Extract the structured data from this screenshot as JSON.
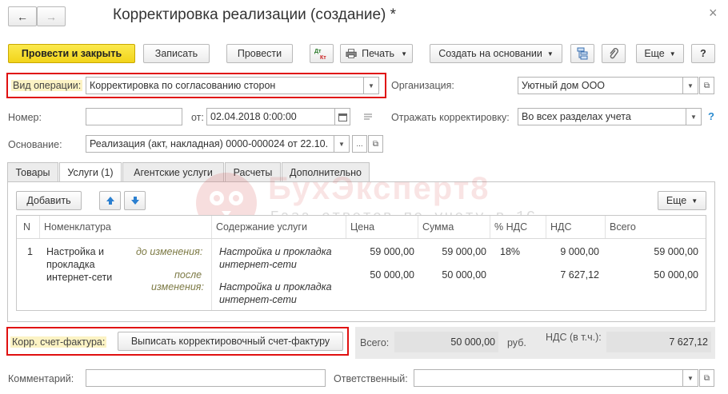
{
  "window": {
    "title": "Корректировка реализации (создание) *",
    "nav_back": "←",
    "nav_forward": "→",
    "close": "×"
  },
  "toolbar": {
    "post_close": "Провести и закрыть",
    "save": "Записать",
    "post": "Провести",
    "dtkt": "Дт Кт",
    "print": "Печать",
    "create_based": "Создать на основании",
    "more": "Еще",
    "help": "?"
  },
  "header": {
    "operation_label": "Вид операции:",
    "operation_value": "Корректировка по согласованию сторон",
    "org_label": "Организация:",
    "org_value": "Уютный дом ООО",
    "number_label": "Номер:",
    "number_value": "",
    "date_label": "от:",
    "date_value": "02.04.2018  0:00:00",
    "reflect_label": "Отражать корректировку:",
    "reflect_value": "Во всех разделах учета",
    "help_q": "?",
    "basis_label": "Основание:",
    "basis_value": "Реализация (акт, накладная) 0000-000024 от 22.10.",
    "basis_dots": "..."
  },
  "tabs": [
    "Товары",
    "Услуги (1)",
    "Агентские услуги",
    "Расчеты",
    "Дополнительно"
  ],
  "watermark": {
    "title": "БухЭксперт8",
    "subtitle": "База ответов по учету в 1С"
  },
  "table_toolbar": {
    "add": "Добавить",
    "more": "Еще"
  },
  "table": {
    "headers": [
      "N",
      "Номенклатура",
      "Содержание услуги",
      "Цена",
      "Сумма",
      "% НДС",
      "НДС",
      "Всего"
    ],
    "row": {
      "n": "1",
      "item": [
        "Настройка и",
        "прокладка",
        "интернет-сети"
      ],
      "before_label": "до изменения:",
      "after_label": [
        "после",
        "изменения:"
      ],
      "content_before": [
        "Настройка и прокладка",
        "интернет-сети"
      ],
      "content_after": [
        "Настройка и прокладка",
        "интернет-сети"
      ],
      "price_before": "59 000,00",
      "price_after": "50 000,00",
      "sum_before": "59 000,00",
      "sum_after": "50 000,00",
      "vat_rate": "18%",
      "vat_before": "9 000,00",
      "vat_after": "7 627,12",
      "total_before": "59 000,00",
      "total_after": "50 000,00"
    }
  },
  "footer": {
    "invoice_label": "Корр. счет-фактура:",
    "invoice_button": "Выписать корректировочный счет-фактуру",
    "total_label": "Всего:",
    "total_value": "50 000,00",
    "currency": "руб.",
    "vat_label": "НДС (в т.ч.):",
    "vat_value": "7 627,12",
    "comment_label": "Комментарий:",
    "comment_value": "",
    "responsible_label": "Ответственный:",
    "responsible_value": ""
  },
  "colors": {
    "primary_button": "#f2d41a",
    "highlight_frame": "#e01010",
    "watermark": "#d23a3a"
  }
}
